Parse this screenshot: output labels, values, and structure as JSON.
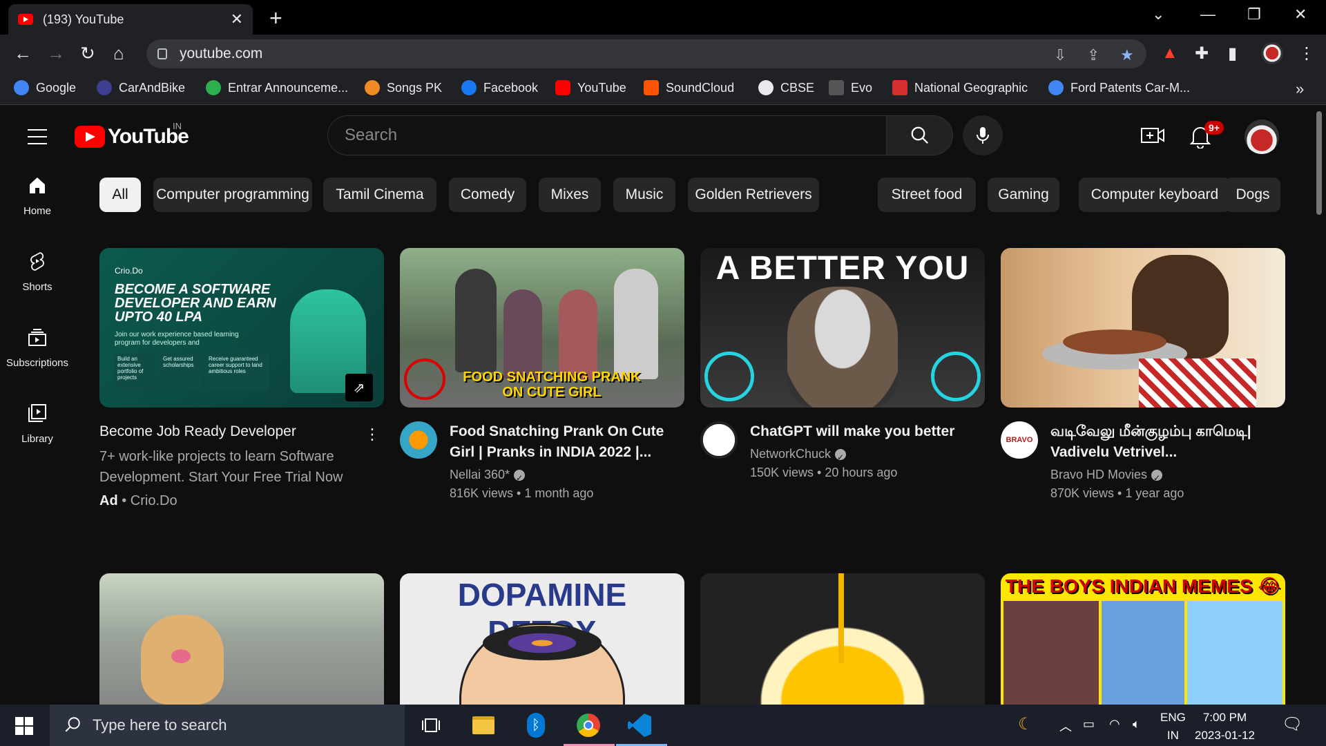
{
  "browser": {
    "tab_title": "(193) YouTube",
    "url": "youtube.com",
    "bookmarks": [
      {
        "label": "Google",
        "color": "#4285f4"
      },
      {
        "label": "CarAndBike",
        "color": "#3c3f8f"
      },
      {
        "label": "Entrar Announceme...",
        "color": "#2eaf4e"
      },
      {
        "label": "Songs PK",
        "color": "#f08a24"
      },
      {
        "label": "Facebook",
        "color": "#1877f2"
      },
      {
        "label": "YouTube",
        "color": "#ff0000"
      },
      {
        "label": "SoundCloud",
        "color": "#ff5500"
      },
      {
        "label": "CBSE",
        "color": "#e8eaed"
      },
      {
        "label": "Evo",
        "color": "#e8eaed"
      },
      {
        "label": "National Geographic",
        "color": "#d32f2f"
      },
      {
        "label": "Ford Patents Car-M...",
        "color": "#4285f4"
      }
    ],
    "bookmarks_overflow": "»"
  },
  "youtube": {
    "logo_text": "YouTube",
    "country_code": "IN",
    "search_placeholder": "Search",
    "notification_count": "9+",
    "sidenav": [
      {
        "label": "Home",
        "icon": "home-icon"
      },
      {
        "label": "Shorts",
        "icon": "shorts-icon"
      },
      {
        "label": "Subscriptions",
        "icon": "subscriptions-icon"
      },
      {
        "label": "Library",
        "icon": "library-icon"
      }
    ],
    "chips": [
      "All",
      "Computer programming",
      "Tamil Cinema",
      "Comedy",
      "Mixes",
      "Music",
      "Golden Retrievers",
      "Street food",
      "Gaming",
      "Computer keyboard",
      "Dogs"
    ],
    "ad": {
      "title": "Become Job Ready Developer",
      "description": "7+ work-like projects to learn Software Development. Start Your Free Trial Now",
      "ad_label": "Ad",
      "advertiser": "Crio.Do",
      "thumb_brand": "Crio.Do",
      "thumb_headline": "BECOME A SOFTWARE DEVELOPER AND EARN UPTO 40 LPA",
      "thumb_sub": "Join our work experience based learning program for developers and",
      "thumb_boxes": [
        "Build an extensive portfolio of projects",
        "Get assured scholarships",
        "Receive guaranteed career support to land ambitious roles"
      ]
    },
    "videos": [
      {
        "title": "Food Snatching Prank On Cute Girl | Pranks in INDIA 2022 |...",
        "channel": "Nellai 360*",
        "verified": true,
        "stats": "816K views • 1 month ago",
        "thumb_text": "FOOD SNATCHING PRANK ON CUTE GIRL"
      },
      {
        "title": "ChatGPT will make you better",
        "channel": "NetworkChuck",
        "verified": true,
        "stats": "150K views • 20 hours ago",
        "thumb_text": "A BETTER YOU"
      },
      {
        "title": "வடிவேலு மீன்குழம்பு காமெடி| Vadivelu Vetrivel...",
        "channel": "Bravo HD Movies",
        "verified": true,
        "stats": "870K views • 1 year ago",
        "thumb_text": ""
      }
    ],
    "row2_thumbs": [
      "",
      "DOPAMINE DETOX",
      "",
      "THE BOYS INDIAN MEMES 😂"
    ]
  },
  "taskbar": {
    "search_placeholder": "Type here to search",
    "lang_top": "ENG",
    "lang_bottom": "IN",
    "time": "7:00 PM",
    "date": "2023-01-12"
  }
}
